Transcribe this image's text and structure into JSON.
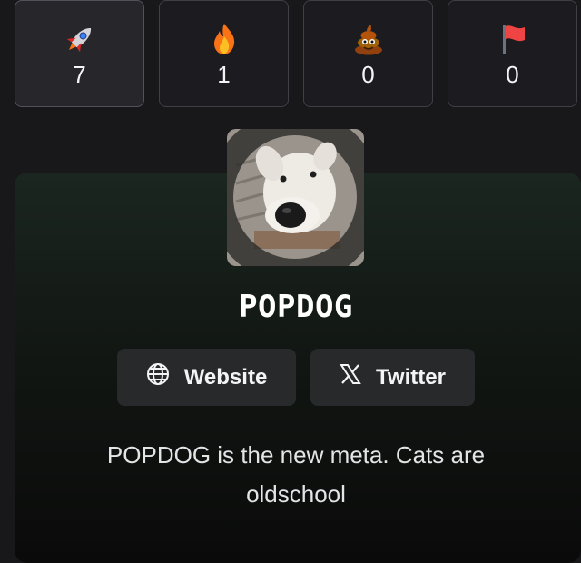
{
  "reactions": [
    {
      "icon": "rocket-icon",
      "count": "7",
      "active": true
    },
    {
      "icon": "fire-icon",
      "count": "1",
      "active": false
    },
    {
      "icon": "poop-icon",
      "count": "0",
      "active": false
    },
    {
      "icon": "red-flag-icon",
      "count": "0",
      "active": false
    }
  ],
  "token": {
    "name": "POPDOG",
    "description": "POPDOG is the new meta. Cats are oldschool"
  },
  "links": {
    "website_label": "Website",
    "twitter_label": "Twitter"
  },
  "colors": {
    "background": "#18181b",
    "card_gradient_top": "#1b2620",
    "button_bg": "#27292b"
  }
}
